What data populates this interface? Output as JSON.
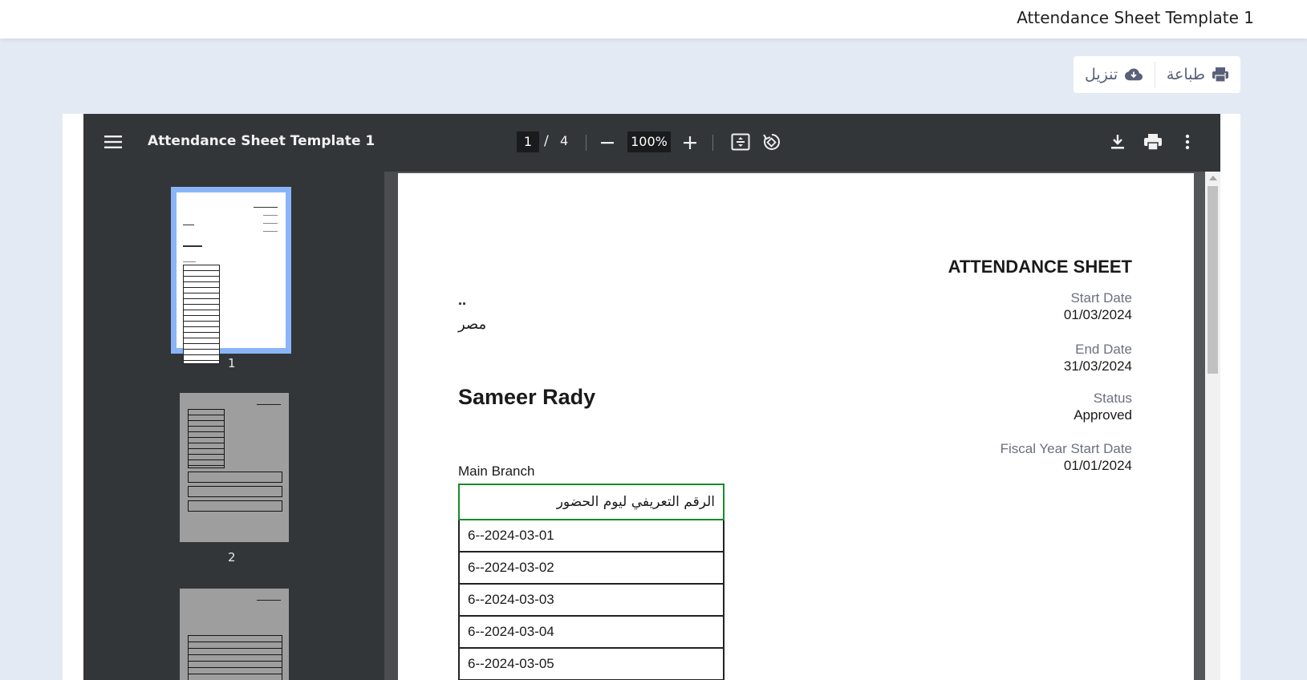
{
  "topbar": {
    "title": "Attendance Sheet Template 1"
  },
  "actions": {
    "print_label": "طباعة",
    "download_label": "تنزيل"
  },
  "viewer": {
    "doc_title": "Attendance Sheet Template 1",
    "page_current": "1",
    "page_separator": "/",
    "page_total": "4",
    "zoom": "100%",
    "thumbnails": [
      {
        "label": "1"
      },
      {
        "label": "2"
      }
    ],
    "icons": [
      "menu-icon",
      "zoom-out-icon",
      "zoom-in-icon",
      "fit-page-icon",
      "rotate-icon",
      "download-icon",
      "print-icon",
      "more-vert-icon"
    ]
  },
  "page": {
    "title": "ATTENDANCE SHEET",
    "start_date_label": "Start Date",
    "start_date": "01/03/2024",
    "end_date_label": "End Date",
    "end_date": "31/03/2024",
    "status_label": "Status",
    "status": "Approved",
    "fiscal_label": "Fiscal Year Start Date",
    "fiscal_value": "01/01/2024",
    "dots": "..",
    "country": "مصر",
    "employee_name": "Sameer Rady",
    "branch": "Main Branch",
    "table_header": "الرقم التعريفي ليوم الحضور",
    "rows": [
      "6--2024-03-01",
      "6--2024-03-02",
      "6--2024-03-03",
      "6--2024-03-04",
      "6--2024-03-05"
    ]
  },
  "colors": {
    "accent": "#8ab4f8",
    "toolbar": "#323639",
    "table_highlight": "#1a8a2c"
  }
}
